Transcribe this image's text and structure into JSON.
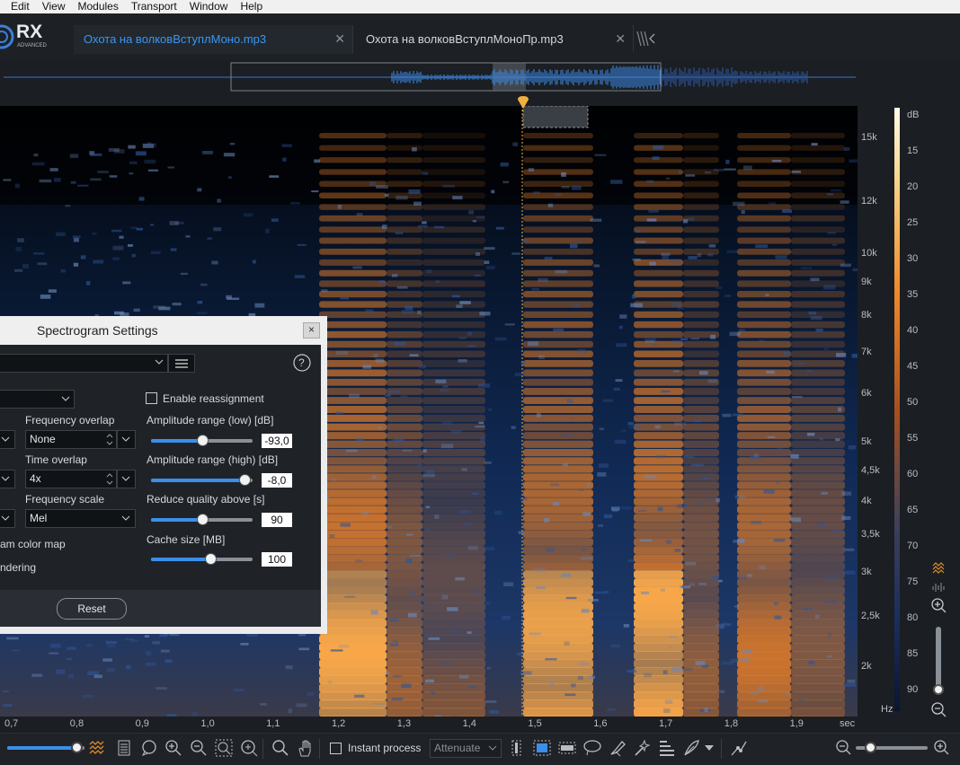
{
  "menu": [
    "Edit",
    "View",
    "Modules",
    "Transport",
    "Window",
    "Help"
  ],
  "logo": {
    "text": "RX",
    "subtext": "ADVANCED"
  },
  "tabs": [
    {
      "label": "Охота на волковВступлМоно.mp3",
      "close": "✕",
      "active": true
    },
    {
      "label": "Охота на волковВступлМоноПр.mp3",
      "close": "✕",
      "active": false
    }
  ],
  "frequency_axis": {
    "labels": [
      "15k",
      "12k",
      "10k",
      "9k",
      "8k",
      "7k",
      "6k",
      "5k",
      "4,5k",
      "4k",
      "3,5k",
      "3k",
      "2,5k",
      "2k",
      "Hz"
    ]
  },
  "db_axis": {
    "labels": [
      "dB",
      "15",
      "20",
      "25",
      "30",
      "35",
      "40",
      "45",
      "50",
      "55",
      "60",
      "65",
      "70",
      "75",
      "80",
      "85",
      "90"
    ]
  },
  "time_axis": {
    "labels": [
      "0,7",
      "0,8",
      "0,9",
      "1,0",
      "1,1",
      "1,2",
      "1,3",
      "1,4",
      "1,5",
      "1,6",
      "1,7",
      "1,8",
      "1,9",
      "sec"
    ]
  },
  "dialog": {
    "title": "Spectrogram Settings",
    "close": "×",
    "help": "?",
    "enable_reassignment": "Enable reassignment",
    "frequency_overlap_label": "Frequency overlap",
    "frequency_overlap_value": "None",
    "time_overlap_label": "Time overlap",
    "time_overlap_value": "4x",
    "frequency_scale_label": "Frequency scale",
    "frequency_scale_value": "Mel",
    "color_map_label": "am color map",
    "rendering_label": "ndering",
    "amp_low_label": "Amplitude range (low)  [dB]",
    "amp_low_value": "-93,0",
    "amp_low_level": 0.5,
    "amp_high_label": "Amplitude range (high)  [dB]",
    "amp_high_value": "-8,0",
    "amp_high_level": 0.92,
    "reduce_quality_label": "Reduce quality above [s]",
    "reduce_quality_value": "90",
    "reduce_quality_level": 0.5,
    "cache_label": "Cache size [MB]",
    "cache_value": "100",
    "cache_level": 0.58,
    "reset_label": "Reset"
  },
  "toolbar": {
    "instant_process": "Instant process",
    "attenuate": "Attenuate",
    "spectrogram_slider_level": 0.9,
    "zoom_slider_level": 0.2
  },
  "colors": {
    "accent": "#3b8fe8",
    "playhead": "#f0b040",
    "spectrum_hot": "#f08a2c",
    "spectrum_cold": "#1a3a70"
  }
}
